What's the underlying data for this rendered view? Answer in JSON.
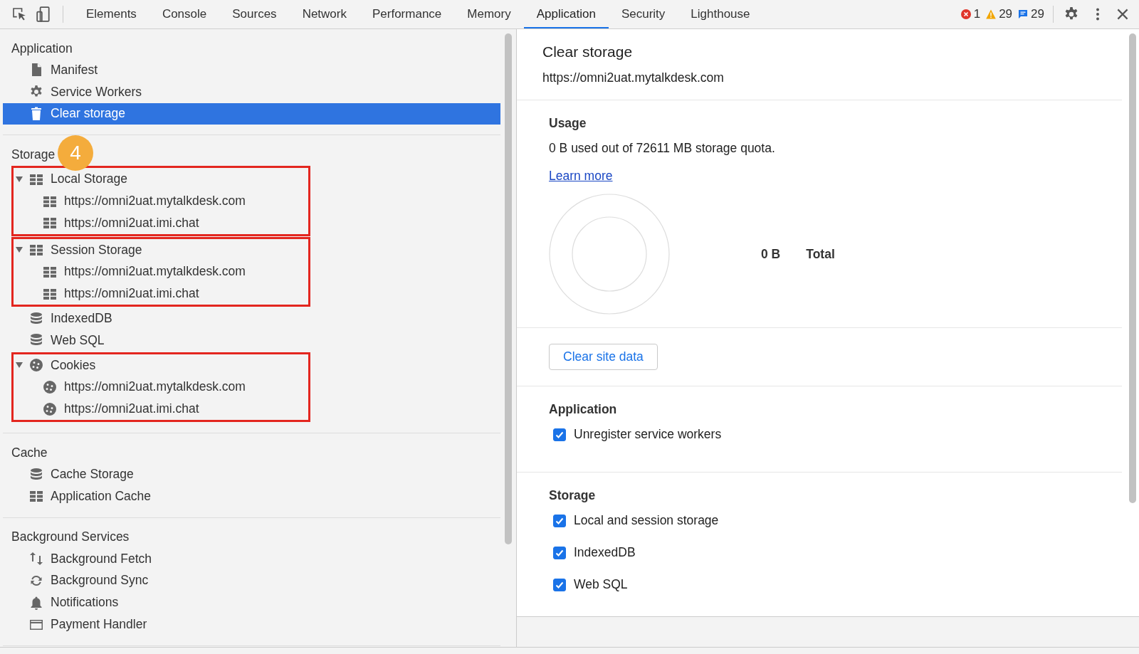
{
  "toolbar": {
    "tabs": [
      {
        "label": "Elements",
        "selected": false
      },
      {
        "label": "Console",
        "selected": false
      },
      {
        "label": "Sources",
        "selected": false
      },
      {
        "label": "Network",
        "selected": false
      },
      {
        "label": "Performance",
        "selected": false
      },
      {
        "label": "Memory",
        "selected": false
      },
      {
        "label": "Application",
        "selected": true
      },
      {
        "label": "Security",
        "selected": false
      },
      {
        "label": "Lighthouse",
        "selected": false
      }
    ],
    "errors": "1",
    "warnings": "29",
    "messages": "29"
  },
  "sidebar": {
    "sections": [
      {
        "title": "Application",
        "items": [
          {
            "label": "Manifest",
            "kind": "file",
            "selected": false
          },
          {
            "label": "Service Workers",
            "kind": "gear",
            "selected": false
          },
          {
            "label": "Clear storage",
            "kind": "trash",
            "selected": true
          }
        ]
      },
      {
        "title": "Storage",
        "badge": "4",
        "items": [
          {
            "label": "Local Storage",
            "kind": "grid",
            "selected": false,
            "expanded": true,
            "highlighted": true,
            "children": [
              {
                "label": "https://omni2uat.mytalkdesk.com",
                "kind": "grid",
                "selected": false
              },
              {
                "label": "https://omni2uat.imi.chat",
                "kind": "grid",
                "selected": false
              }
            ]
          },
          {
            "label": "Session Storage",
            "kind": "grid",
            "selected": false,
            "expanded": true,
            "highlighted": true,
            "children": [
              {
                "label": "https://omni2uat.mytalkdesk.com",
                "kind": "grid",
                "selected": false
              },
              {
                "label": "https://omni2uat.imi.chat",
                "kind": "grid",
                "selected": false
              }
            ]
          },
          {
            "label": "IndexedDB",
            "kind": "database",
            "selected": false
          },
          {
            "label": "Web SQL",
            "kind": "database",
            "selected": false
          },
          {
            "label": "Cookies",
            "kind": "cookie",
            "selected": false,
            "expanded": true,
            "highlighted": true,
            "children": [
              {
                "label": "https://omni2uat.mytalkdesk.com",
                "kind": "cookie",
                "selected": false
              },
              {
                "label": "https://omni2uat.imi.chat",
                "kind": "cookie",
                "selected": false
              }
            ]
          }
        ]
      },
      {
        "title": "Cache",
        "items": [
          {
            "label": "Cache Storage",
            "kind": "database",
            "selected": false
          },
          {
            "label": "Application Cache",
            "kind": "grid",
            "selected": false
          }
        ]
      },
      {
        "title": "Background Services",
        "items": [
          {
            "label": "Background Fetch",
            "kind": "arrows",
            "selected": false
          },
          {
            "label": "Background Sync",
            "kind": "sync",
            "selected": false
          },
          {
            "label": "Notifications",
            "kind": "bell",
            "selected": false
          },
          {
            "label": "Payment Handler",
            "kind": "card",
            "selected": false
          }
        ]
      }
    ]
  },
  "content": {
    "title": "Clear storage",
    "origin": "https://omni2uat.mytalkdesk.com",
    "usage": {
      "heading": "Usage",
      "quota": "0 B used out of 72611 MB storage quota.",
      "link": "Learn more",
      "total_value": "0 B",
      "total_label": "Total"
    },
    "clear_button": "Clear site data",
    "groups": [
      {
        "heading": "Application",
        "options": [
          {
            "label": "Unregister service workers",
            "checked": true
          }
        ]
      },
      {
        "heading": "Storage",
        "options": [
          {
            "label": "Local and session storage",
            "checked": true
          },
          {
            "label": "IndexedDB",
            "checked": true
          },
          {
            "label": "Web SQL",
            "checked": true
          }
        ]
      }
    ]
  }
}
